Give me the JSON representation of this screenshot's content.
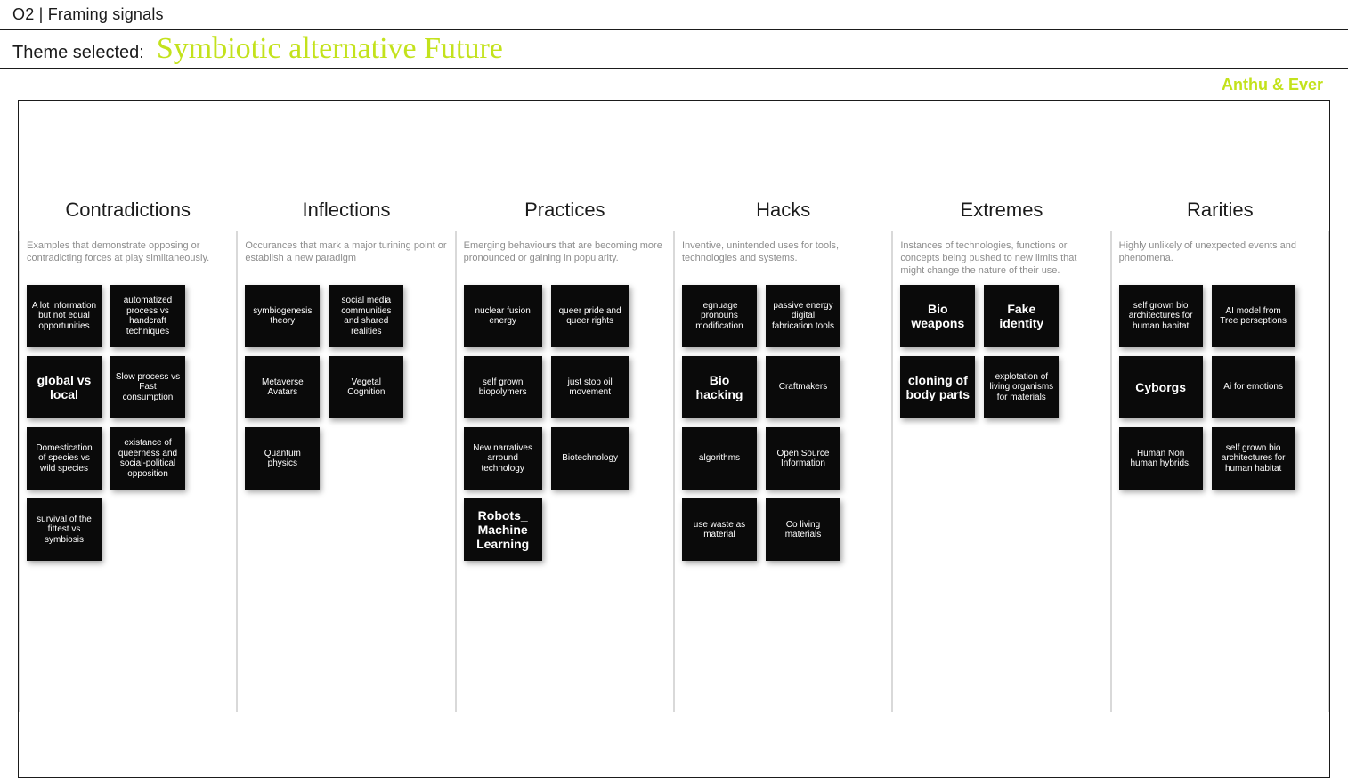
{
  "page_title": "O2 | Framing signals",
  "theme_label": "Theme selected:",
  "theme_value": "Symbiotic alternative Future",
  "authors": "Anthu & Ever",
  "columns": [
    {
      "title": "Contradictions",
      "desc": "Examples that demonstrate opposing or contradicting forces at play similtaneously.",
      "cards": [
        {
          "text": "A lot Information but not equal opportunities"
        },
        {
          "text": "automatized process vs handcraft techniques"
        },
        {
          "text": "global vs local",
          "big": true
        },
        {
          "text": "Slow process vs Fast consumption"
        },
        {
          "text": "Domestication of species vs wild species"
        },
        {
          "text": "existance of queerness and social-political opposition"
        },
        {
          "text": "survival of the fittest vs symbiosis"
        }
      ]
    },
    {
      "title": "Inflections",
      "desc": "Occurances that mark a major turining point or establish a new paradigm",
      "cards": [
        {
          "text": "symbiogenesis theory"
        },
        {
          "text": "social media communities and shared realities"
        },
        {
          "text": "Metaverse Avatars"
        },
        {
          "text": "Vegetal Cognition"
        },
        {
          "text": "Quantum physics"
        }
      ]
    },
    {
      "title": "Practices",
      "desc": "Emerging behaviours that are becoming more pronounced or gaining in popularity.",
      "cards": [
        {
          "text": "nuclear fusion energy"
        },
        {
          "text": "queer pride and queer rights"
        },
        {
          "text": "self grown biopolymers"
        },
        {
          "text": "just stop oil movement"
        },
        {
          "text": "New narratives arround technology"
        },
        {
          "text": "Biotechnology"
        },
        {
          "text": "Robots_ Machine Learning",
          "big": true
        }
      ]
    },
    {
      "title": "Hacks",
      "desc": "Inventive, unintended uses for tools, technologies and systems.",
      "cards": [
        {
          "text": "legnuage pronouns modification"
        },
        {
          "text": "passive energy digital fabrication tools"
        },
        {
          "text": "Bio hacking",
          "big": true
        },
        {
          "text": "Craftmakers"
        },
        {
          "text": "algorithms"
        },
        {
          "text": "Open Source Information"
        },
        {
          "text": "use waste as material"
        },
        {
          "text": "Co living materials"
        }
      ]
    },
    {
      "title": "Extremes",
      "desc": "Instances of technologies, functions or concepts being pushed to new limits that might change the nature of their use.",
      "cards": [
        {
          "text": "Bio weapons",
          "big": true
        },
        {
          "text": "Fake identity",
          "big": true
        },
        {
          "text": "cloning of body parts",
          "big": true
        },
        {
          "text": "explotation of living organisms for materials"
        }
      ]
    },
    {
      "title": "Rarities",
      "desc": "Highly unlikely of unexpected events and phenomena.",
      "cards": [
        {
          "text": "self grown bio architectures for human habitat"
        },
        {
          "text": "AI model from Tree perseptions"
        },
        {
          "text": "Cyborgs",
          "big": true
        },
        {
          "text": "Ai for emotions"
        },
        {
          "text": "Human Non human hybrids."
        },
        {
          "text": "self grown bio architectures for human habitat"
        }
      ]
    }
  ]
}
